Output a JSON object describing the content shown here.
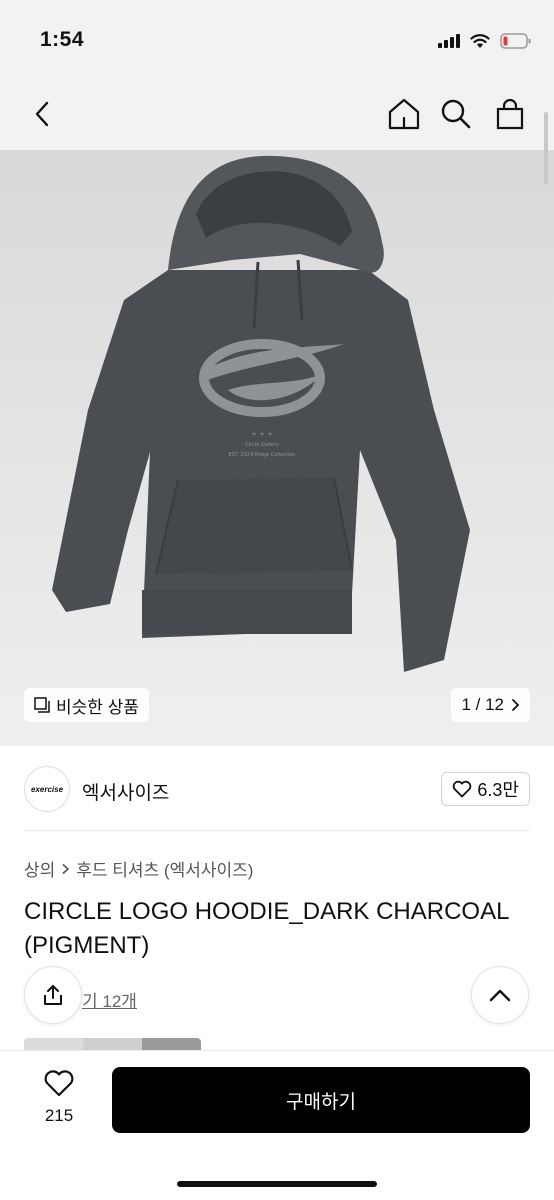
{
  "status_bar": {
    "time": "1:54"
  },
  "gallery": {
    "similar_label": "비슷한 상품",
    "counter": "1 / 12",
    "print_line1": "+ + +",
    "print_line2": "Circle Gallery",
    "print_line3": "EST. 2024 Ridge Collection"
  },
  "brand": {
    "logo_text": "exercise",
    "name": "엑서사이즈",
    "likes": "6.3만"
  },
  "breadcrumb": {
    "level1": "상의",
    "level2": "후드 티셔츠 (엑서사이즈)"
  },
  "product": {
    "title": "CIRCLE LOGO HOODIE_DARK CHARCOAL (PIGMENT)",
    "review_text": "기 12개"
  },
  "bottom_bar": {
    "wish_count": "215",
    "buy_label": "구매하기"
  },
  "colors": {
    "accent": "#000000",
    "hoodie": "#4a4d52",
    "background": "#e4e4e4"
  }
}
